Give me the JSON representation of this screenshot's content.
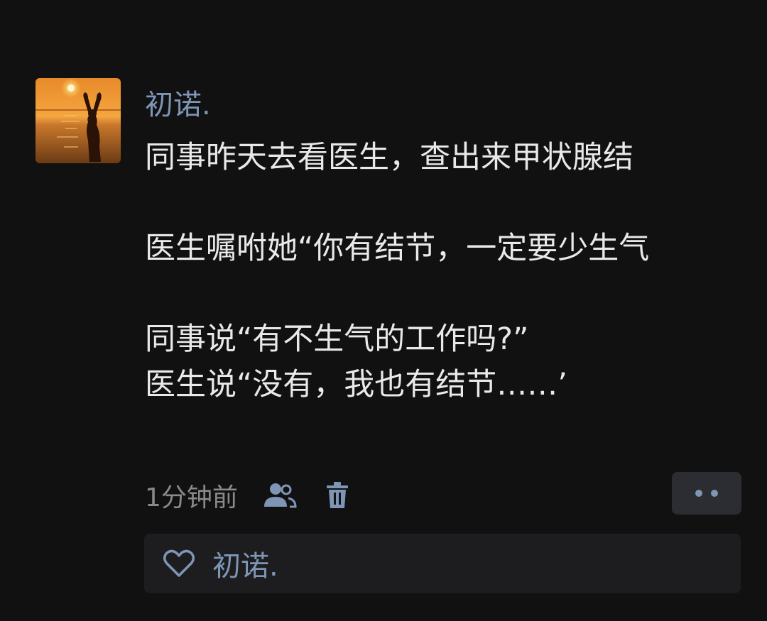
{
  "post": {
    "author": "初诺.",
    "paragraphs": [
      "同事昨天去看医生，查出来甲状腺结",
      "医生嘱咐她“你有结节，一定要少生气",
      "同事说“有不生气的工作吗?”\n医生说“没有，我也有结节……’"
    ],
    "timestamp": "1分钟前",
    "visibility_icon": "friends-icon",
    "delete_icon": "trash-icon",
    "more_icon": "more-dots-icon"
  },
  "likes": {
    "icon": "heart-icon",
    "names": "初诺."
  },
  "colors": {
    "background": "#111111",
    "name_accent": "#7e95b6",
    "text": "#e9e9e9",
    "muted": "#8a8a8a",
    "panel": "#1d1d1f",
    "button_bg": "#2b2d32"
  }
}
